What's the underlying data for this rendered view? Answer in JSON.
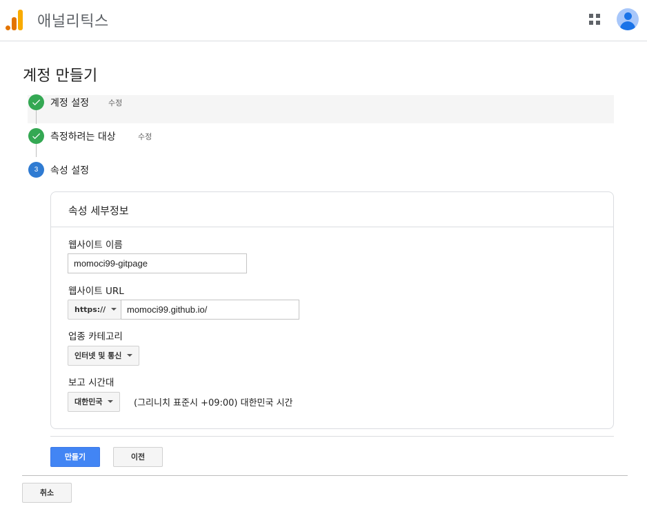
{
  "header": {
    "app_title": "애널리틱스"
  },
  "page": {
    "title": "계정 만들기"
  },
  "steps": [
    {
      "label": "계정 설정",
      "edit": "수정",
      "status": "done"
    },
    {
      "label": "측정하려는 대상",
      "edit": "수정",
      "status": "done"
    },
    {
      "label": "속성 설정",
      "number": "3",
      "status": "current"
    }
  ],
  "card": {
    "title": "속성 세부정보",
    "website_name": {
      "label": "웹사이트 이름",
      "value": "momoci99-gitpage"
    },
    "website_url": {
      "label": "웹사이트 URL",
      "protocol": "https://",
      "value": "momoci99.github.io/"
    },
    "industry": {
      "label": "업종 카테고리",
      "selected": "인터넷 및 통신"
    },
    "timezone": {
      "label": "보고 시간대",
      "country": "대한민국",
      "zone": "(그리니치 표준시 +09:00) 대한민국 시간"
    }
  },
  "actions": {
    "create": "만들기",
    "previous": "이전",
    "cancel": "취소"
  },
  "colors": {
    "primary": "#4285f4",
    "step_done": "#34a853",
    "step_current": "#2f7bd2",
    "logo_orange": "#e37400",
    "logo_yellow": "#f9ab00"
  }
}
